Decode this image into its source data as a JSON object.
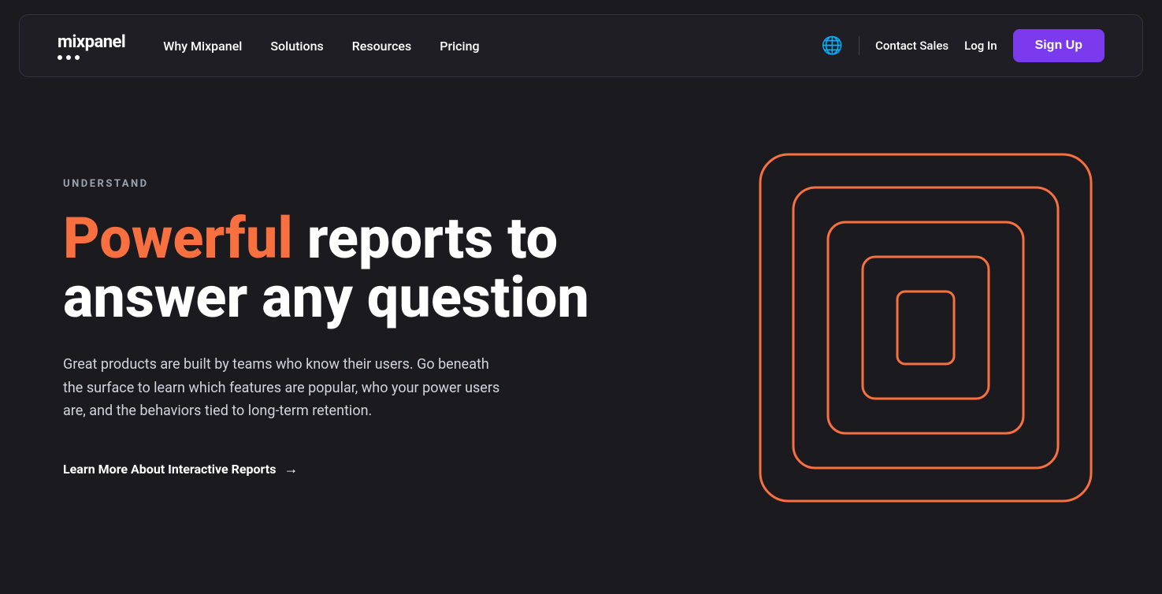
{
  "navbar": {
    "logo": {
      "text": "mixpanel"
    },
    "nav_links": [
      {
        "label": "Why Mixpanel",
        "id": "why-mixpanel"
      },
      {
        "label": "Solutions",
        "id": "solutions"
      },
      {
        "label": "Resources",
        "id": "resources"
      },
      {
        "label": "Pricing",
        "id": "pricing"
      }
    ],
    "contact_sales_label": "Contact Sales",
    "login_label": "Log In",
    "signup_label": "Sign Up"
  },
  "hero": {
    "eyebrow": "UNDERSTAND",
    "heading_accent": "Powerful",
    "heading_rest": " reports to answer any question",
    "description": "Great products are built by teams who know their users. Go beneath the surface to learn which features are popular, who your power users are, and the behaviors tied to long-term retention.",
    "cta_label": "Learn More About Interactive Reports",
    "cta_arrow": "→"
  },
  "colors": {
    "accent": "#f97040",
    "purple": "#7c3aed",
    "bg": "#1a1a1f",
    "nav_bg": "#1e1e24"
  }
}
